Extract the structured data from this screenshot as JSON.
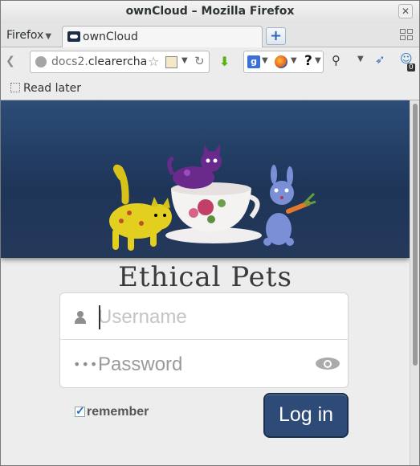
{
  "window": {
    "title": "ownCloud – Mozilla Firefox",
    "close_glyph": "✕"
  },
  "browser": {
    "app_menu_label": "Firefox",
    "tab": {
      "title": "ownCloud"
    },
    "new_tab_glyph": "+",
    "url": {
      "prefix": "docs2.",
      "host": "clearerchar"
    },
    "search_help_glyph": "?",
    "extension_badge": "0",
    "bookmark_item": "Read later"
  },
  "page": {
    "brand_title": "Ethical Pets",
    "username_placeholder": "Username",
    "password_placeholder": "Password",
    "remember_label": "remember",
    "remember_checked": true,
    "login_label": "Log in",
    "colors": {
      "header_bg": "#2c4d78",
      "login_button": "#2e4b78",
      "page_bg": "#ededed"
    }
  }
}
